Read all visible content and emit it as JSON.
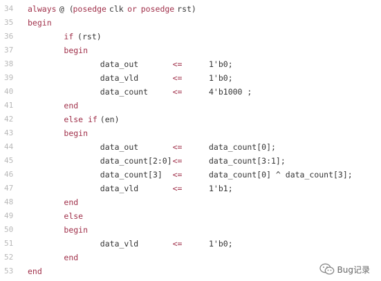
{
  "code_lines": [
    {
      "num": "34",
      "segments": [
        {
          "text": "always",
          "kind": "kw",
          "col": 0
        },
        {
          "text": "@ (",
          "kind": "tx",
          "col": 7
        },
        {
          "text": "posedge",
          "kind": "kw",
          "col": 10
        },
        {
          "text": "clk",
          "kind": "tx",
          "col": 18
        },
        {
          "text": "or",
          "kind": "kw",
          "col": 22
        },
        {
          "text": "posedge",
          "kind": "kw",
          "col": 25
        },
        {
          "text": "rst)",
          "kind": "tx",
          "col": 33
        }
      ]
    },
    {
      "num": "35",
      "segments": [
        {
          "text": "begin",
          "kind": "kw",
          "col": 0
        }
      ]
    },
    {
      "num": "36",
      "segments": [
        {
          "text": "if",
          "kind": "kw",
          "col": 8
        },
        {
          "text": "(rst)",
          "kind": "tx",
          "col": 11
        }
      ]
    },
    {
      "num": "37",
      "segments": [
        {
          "text": "begin",
          "kind": "kw",
          "col": 8
        }
      ]
    },
    {
      "num": "38",
      "segments": [
        {
          "text": "data_out",
          "kind": "tx",
          "col": 16
        },
        {
          "text": "<=",
          "kind": "op",
          "col": 32
        },
        {
          "text": "1'b0;",
          "kind": "tx",
          "col": 40
        }
      ]
    },
    {
      "num": "39",
      "segments": [
        {
          "text": "data_vld",
          "kind": "tx",
          "col": 16
        },
        {
          "text": "<=",
          "kind": "op",
          "col": 32
        },
        {
          "text": "1'b0;",
          "kind": "tx",
          "col": 40
        }
      ]
    },
    {
      "num": "40",
      "segments": [
        {
          "text": "data_count",
          "kind": "tx",
          "col": 16
        },
        {
          "text": "<=",
          "kind": "op",
          "col": 32
        },
        {
          "text": "4'b1000 ;",
          "kind": "tx",
          "col": 40
        }
      ]
    },
    {
      "num": "41",
      "segments": [
        {
          "text": "end",
          "kind": "kw",
          "col": 8
        }
      ]
    },
    {
      "num": "42",
      "segments": [
        {
          "text": "else if",
          "kind": "kw",
          "col": 8
        },
        {
          "text": "(en)",
          "kind": "tx",
          "col": 16
        }
      ]
    },
    {
      "num": "43",
      "segments": [
        {
          "text": "begin",
          "kind": "kw",
          "col": 8
        }
      ]
    },
    {
      "num": "44",
      "segments": [
        {
          "text": "data_out",
          "kind": "tx",
          "col": 16
        },
        {
          "text": "<=",
          "kind": "op",
          "col": 32
        },
        {
          "text": "data_count[0];",
          "kind": "tx",
          "col": 40
        }
      ]
    },
    {
      "num": "45",
      "segments": [
        {
          "text": "data_count[2:0]",
          "kind": "tx",
          "col": 16
        },
        {
          "text": "<=",
          "kind": "op",
          "col": 32
        },
        {
          "text": "data_count[3:1];",
          "kind": "tx",
          "col": 40
        }
      ]
    },
    {
      "num": "46",
      "segments": [
        {
          "text": "data_count[3]",
          "kind": "tx",
          "col": 16
        },
        {
          "text": "<=",
          "kind": "op",
          "col": 32
        },
        {
          "text": "data_count[0] ^ data_count[3];",
          "kind": "tx",
          "col": 40
        }
      ]
    },
    {
      "num": "47",
      "segments": [
        {
          "text": "data_vld",
          "kind": "tx",
          "col": 16
        },
        {
          "text": "<=",
          "kind": "op",
          "col": 32
        },
        {
          "text": "1'b1;",
          "kind": "tx",
          "col": 40
        }
      ]
    },
    {
      "num": "48",
      "segments": [
        {
          "text": "end",
          "kind": "kw",
          "col": 8
        }
      ]
    },
    {
      "num": "49",
      "segments": [
        {
          "text": "else",
          "kind": "kw",
          "col": 8
        }
      ]
    },
    {
      "num": "50",
      "segments": [
        {
          "text": "begin",
          "kind": "kw",
          "col": 8
        }
      ]
    },
    {
      "num": "51",
      "segments": [
        {
          "text": "data_vld",
          "kind": "tx",
          "col": 16
        },
        {
          "text": "<=",
          "kind": "op",
          "col": 32
        },
        {
          "text": "1'b0;",
          "kind": "tx",
          "col": 40
        }
      ]
    },
    {
      "num": "52",
      "segments": [
        {
          "text": "end",
          "kind": "kw",
          "col": 8
        }
      ]
    },
    {
      "num": "53",
      "segments": [
        {
          "text": "end",
          "kind": "kw",
          "col": 0
        }
      ]
    }
  ],
  "watermark": {
    "text": "Bug记录",
    "icon": "wechat-icon"
  },
  "colors": {
    "keyword": "#a0304a",
    "text": "#333333",
    "line_number": "#b8b8b8",
    "background": "#ffffff"
  }
}
